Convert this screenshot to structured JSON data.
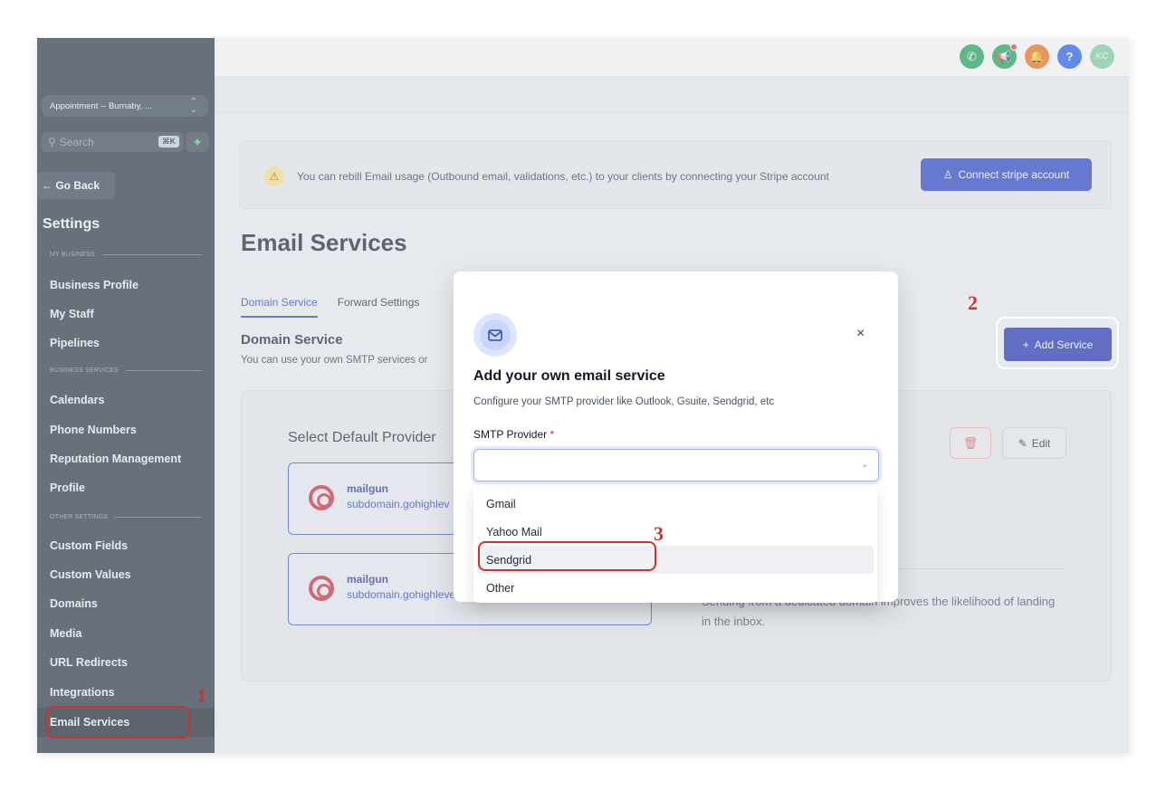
{
  "sidebar": {
    "location": "Appointment -- Burnaby, ...",
    "search_placeholder": "Search",
    "search_shortcut": "⌘K",
    "go_back": "← Go Back",
    "title": "Settings",
    "sections": {
      "my_business": "MY BUSINESS",
      "business_services": "BUSINESS SERVICES",
      "other_settings": "OTHER SETTINGS"
    },
    "items": {
      "business_profile": "Business Profile",
      "my_staff": "My Staff",
      "pipelines": "Pipelines",
      "calendars": "Calendars",
      "phone_numbers": "Phone Numbers",
      "reputation_management": "Reputation Management",
      "profile": "Profile",
      "custom_fields": "Custom Fields",
      "custom_values": "Custom Values",
      "domains": "Domains",
      "media": "Media",
      "url_redirects": "URL Redirects",
      "integrations": "Integrations",
      "email_services": "Email Services"
    }
  },
  "topbar": {
    "avatar_initials": "KC",
    "help": "?",
    "colors": {
      "phone": "#22a55a",
      "megaphone": "#22a55a",
      "bell": "#f97316",
      "help": "#2563eb",
      "avatar": "#86d2a4"
    }
  },
  "banner": {
    "text": "You can rebill Email usage (Outbound email, validations, etc.) to your clients by connecting your Stripe account",
    "button": "Connect stripe account"
  },
  "page": {
    "title": "Email Services",
    "tabs": [
      "Domain Service",
      "Forward Settings"
    ],
    "section_title": "Domain Service",
    "section_desc": "You can use your own SMTP services or",
    "add_button": "Add Service",
    "select_default": "Select Default Provider",
    "providers": [
      {
        "name": "mailgun",
        "domain": "subdomain.gohighlev"
      },
      {
        "name": "mailgun",
        "domain": "subdomain.gohighlever.c"
      }
    ],
    "edit_button": "Edit",
    "info_text": "Sending from a dedicated domain improves the likelihood of landing in the inbox."
  },
  "modal": {
    "title": "Add your own email service",
    "subtitle": "Configure your SMTP provider like Outlook, Gsuite, Sendgrid, etc",
    "field_label": "SMTP Provider",
    "required_mark": "*",
    "options": [
      "Gmail",
      "Yahoo Mail",
      "Sendgrid",
      "Other"
    ],
    "close": "×"
  },
  "annotations": [
    "1",
    "2",
    "3"
  ]
}
